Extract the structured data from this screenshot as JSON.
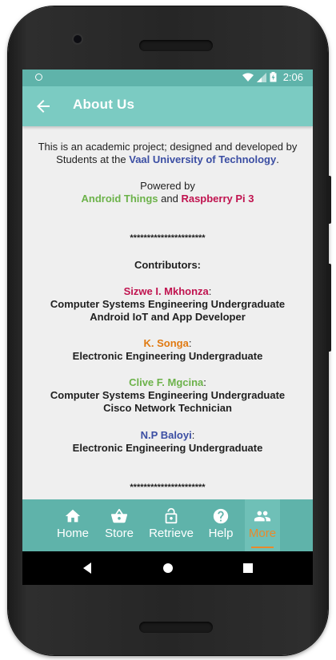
{
  "status_bar": {
    "time": "2:06"
  },
  "app_bar": {
    "title": "About Us"
  },
  "about": {
    "intro_line1": "This is an academic project; designed and developed by",
    "intro_line2_prefix": "Students at the ",
    "university": "Vaal University of Technology",
    "intro_line2_suffix": ".",
    "powered_by": "Powered by",
    "platform1": "Android Things",
    "and_text": " and ",
    "platform2": "Raspberry Pi 3",
    "separator": "**********************",
    "contributors_heading": "Contributors:",
    "colon": ":"
  },
  "contributors": [
    {
      "name": "Sizwe I. Mkhonza",
      "color": "#c0134f",
      "roles": [
        "Computer Systems Engineering Undergraduate",
        "Android IoT and App Developer"
      ]
    },
    {
      "name": "K. Songa",
      "color": "#e07a12",
      "roles": [
        "Electronic Engineering Undergraduate"
      ]
    },
    {
      "name": "Clive F. Mgcina",
      "color": "#6cb24a",
      "roles": [
        "Computer Systems Engineering Undergraduate",
        "Cisco Network Technician"
      ]
    },
    {
      "name": "N.P Baloyi",
      "color": "#3b4ea3",
      "roles": [
        "Electronic Engineering Undergraduate"
      ]
    }
  ],
  "bottom_nav": [
    {
      "label": "Home",
      "icon": "home-icon",
      "active": false
    },
    {
      "label": "Store",
      "icon": "basket-icon",
      "active": false
    },
    {
      "label": "Retrieve",
      "icon": "unlock-icon",
      "active": false
    },
    {
      "label": "Help",
      "icon": "help-icon",
      "active": false
    },
    {
      "label": "More",
      "icon": "people-icon",
      "active": true
    }
  ],
  "colors": {
    "primary": "#7bcbc2",
    "primary_dark": "#5fb3aa",
    "accent": "#e9892a"
  }
}
